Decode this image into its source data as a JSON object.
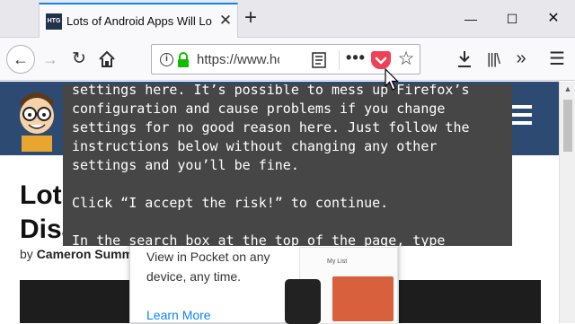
{
  "tab": {
    "favicon_text": "HTG",
    "title": "Lots of Android Apps Will Lose"
  },
  "window": {
    "minimize": "—",
    "maximize": "☐",
    "close": "✕",
    "new_tab": "+"
  },
  "navbar": {
    "url": "https://www.ho",
    "back_glyph": "←",
    "forward_glyph": "→",
    "reload_glyph": "↻",
    "more_glyph": "•••",
    "star_glyph": "☆",
    "library_glyph": "|||\\",
    "overflow_glyph": "»",
    "menu_glyph": "☰",
    "icons": [
      "back-icon",
      "forward-icon",
      "reload-icon",
      "home-icon",
      "info-icon",
      "lock-icon",
      "reader-view-icon",
      "page-actions-icon",
      "pocket-icon",
      "bookmark-star-icon",
      "downloads-icon",
      "library-icon",
      "overflow-icon",
      "menu-icon"
    ]
  },
  "article": {
    "title": "Lots\nDisa",
    "by_prefix": "by ",
    "author": "Cameron Summe"
  },
  "pocket_panel": {
    "text": "View in Pocket on any device, any time.",
    "learn_more": "Learn More",
    "mock_list_title": "My List"
  },
  "overlay": {
    "text": "settings here. It’s possible to mess up Firefox’s configuration and cause problems if you change settings for no good reason here. Just follow the instructions below without changing any other settings and you’ll be fine.\n\nClick “I accept the risk!” to continue.\n\nIn the search box at the top of the page, type"
  },
  "colors": {
    "accent": "#0a84ff",
    "pocket": "#ef4056",
    "site_header": "#2c4a72",
    "overlay_bg": "#464646"
  }
}
